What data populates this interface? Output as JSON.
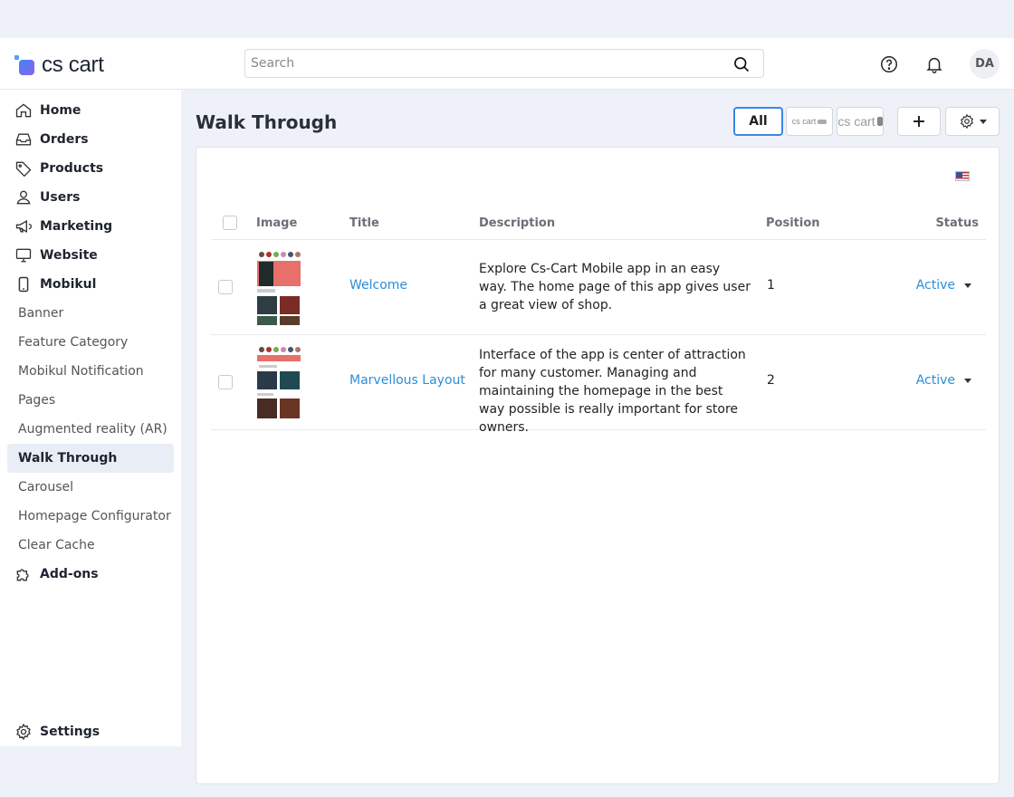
{
  "brand": {
    "logo_text": "cs cart"
  },
  "search": {
    "placeholder": "Search"
  },
  "topbar": {
    "avatar_initials": "DA"
  },
  "sidebar": {
    "main_items": [
      {
        "label": "Home",
        "icon": "home-icon"
      },
      {
        "label": "Orders",
        "icon": "inbox-icon"
      },
      {
        "label": "Products",
        "icon": "tag-icon"
      },
      {
        "label": "Users",
        "icon": "user-icon"
      },
      {
        "label": "Marketing",
        "icon": "megaphone-icon"
      },
      {
        "label": "Website",
        "icon": "monitor-icon"
      },
      {
        "label": "Mobikul",
        "icon": "phone-icon"
      }
    ],
    "sub_items": [
      {
        "label": "Banner"
      },
      {
        "label": "Feature Category"
      },
      {
        "label": "Mobikul Notification"
      },
      {
        "label": "Pages"
      },
      {
        "label": "Augmented reality (AR)"
      },
      {
        "label": "Walk Through",
        "active": true
      },
      {
        "label": "Carousel"
      },
      {
        "label": "Homepage Configurator"
      },
      {
        "label": "Clear Cache"
      }
    ],
    "addons": {
      "label": "Add-ons",
      "icon": "puzzle-icon"
    },
    "settings": {
      "label": "Settings",
      "icon": "gear-icon"
    }
  },
  "page": {
    "title": "Walk Through",
    "filter_all_label": "All",
    "store1_label": "cs cart",
    "store2_label": "cs cart"
  },
  "table": {
    "headers": {
      "image": "Image",
      "title": "Title",
      "description": "Description",
      "position": "Position",
      "status": "Status"
    },
    "rows": [
      {
        "title": "Welcome",
        "description": "Explore Cs-Cart Mobile app in an easy way. The home page of this app gives user a great view of shop.",
        "position": "1",
        "status": "Active"
      },
      {
        "title": "Marvellous Layout",
        "description": "Interface of the app is center of attraction for many customer. Managing and maintaining the homepage in the best way possible is really important for store owners.",
        "position": "2",
        "status": "Active"
      }
    ]
  },
  "colors": {
    "accent": "#2b8ed6",
    "active_bg": "#e9edf5",
    "page_bg": "#eef2f8",
    "brand_gradient_start": "#3f84f5",
    "brand_gradient_end": "#8c62f0"
  }
}
